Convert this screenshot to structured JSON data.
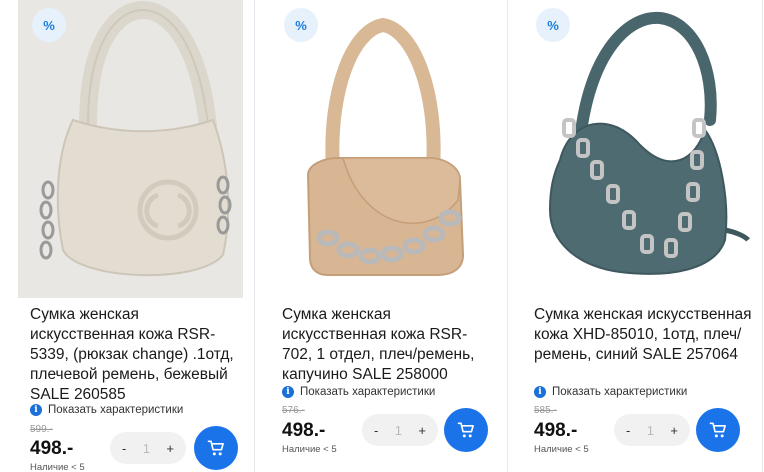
{
  "products": [
    {
      "discount_badge": "%",
      "title": "Сумка женская искусственная кожа RSR-5339, (рюкзак change) .1отд, плечевой ремень, бежевый SALE 260585",
      "specs_label": "Показать характеристики",
      "old_price": "599.-",
      "price": "498.-",
      "availability": "Наличие < 5",
      "quantity": "1",
      "minus_label": "-",
      "plus_label": "+",
      "image_color": "#e8e4dc"
    },
    {
      "discount_badge": "%",
      "title": "Сумка женская искусственная кожа RSR-702, 1 отдел, плеч/ремень, капучино SALE 258000",
      "specs_label": "Показать характеристики",
      "old_price": "576.-",
      "price": "498.-",
      "availability": "Наличие < 5",
      "quantity": "1",
      "minus_label": "-",
      "plus_label": "+",
      "image_color": "#d8b593"
    },
    {
      "discount_badge": "%",
      "title": "Сумка женская искусственная кожа XHD-85010, 1отд, плеч/ремень, синий SALE 257064",
      "specs_label": "Показать характеристики",
      "old_price": "585.-",
      "price": "498.-",
      "availability": "Наличие < 5",
      "quantity": "1",
      "minus_label": "-",
      "plus_label": "+",
      "image_color": "#4e6b72"
    }
  ],
  "colors": {
    "accent": "#1a73e8",
    "badge_bg": "#e6f1fb",
    "badge_fg": "#1a7fe0"
  }
}
